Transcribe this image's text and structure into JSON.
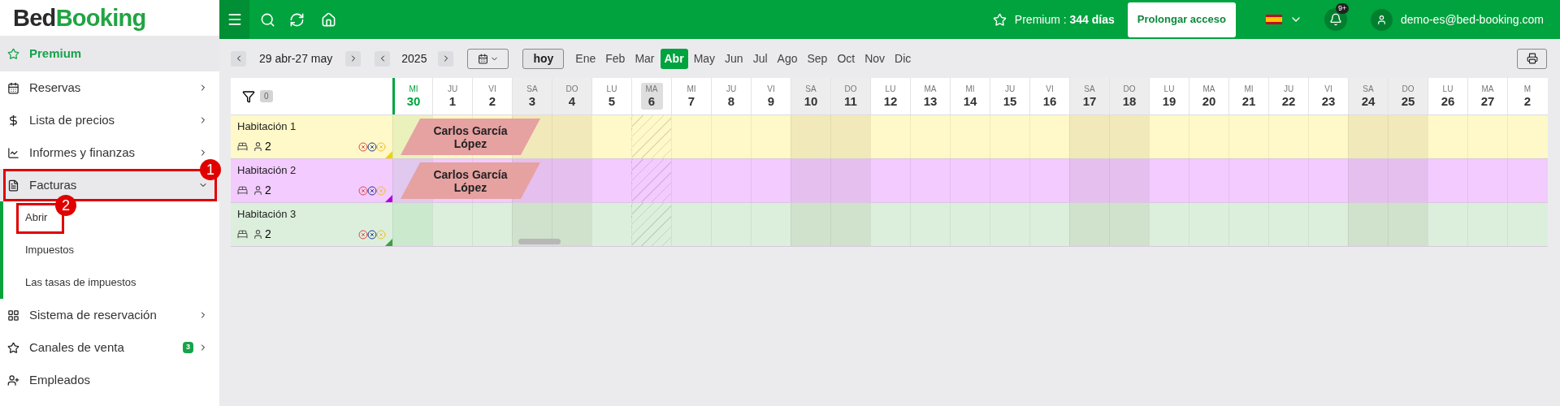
{
  "logo": {
    "part_1": "Bed",
    "part_2": "Booking"
  },
  "sidebar": {
    "items": [
      {
        "label": "Premium",
        "selected": true,
        "has_arrow": false,
        "expanded": false
      },
      {
        "label": "Reservas",
        "selected": false,
        "has_arrow": true,
        "expanded": false
      },
      {
        "label": "Lista de precios",
        "selected": false,
        "has_arrow": true,
        "expanded": false
      },
      {
        "label": "Informes y finanzas",
        "selected": false,
        "has_arrow": true,
        "expanded": false
      },
      {
        "label": "Facturas",
        "selected": false,
        "has_arrow": true,
        "expanded": true,
        "annotation": "1",
        "children": [
          {
            "label": "Abrir",
            "annotation": "2"
          },
          {
            "label": "Impuestos"
          },
          {
            "label": "Las tasas de impuestos"
          }
        ]
      },
      {
        "label": "Sistema de reservación",
        "selected": false,
        "has_arrow": true,
        "expanded": false
      },
      {
        "label": "Canales de venta",
        "selected": false,
        "has_arrow": true,
        "expanded": false,
        "badge": "3"
      },
      {
        "label": "Empleados",
        "selected": false,
        "has_arrow": false,
        "expanded": false
      }
    ]
  },
  "topbar": {
    "premium": "Premium : ",
    "premium_days": "344 días",
    "extend_button": "Prolongar acceso",
    "notifications_badge": "9+",
    "email": "demo-es@bed-booking.com"
  },
  "toolbar": {
    "range": "29 abr-27 may",
    "year": "2025",
    "today_button": "hoy",
    "months": [
      {
        "label": "Ene",
        "selected": false
      },
      {
        "label": "Feb",
        "selected": false
      },
      {
        "label": "Mar",
        "selected": false
      },
      {
        "label": "Abr",
        "selected": true
      },
      {
        "label": "May",
        "selected": false
      },
      {
        "label": "Jun",
        "selected": false
      },
      {
        "label": "Jul",
        "selected": false
      },
      {
        "label": "Ago",
        "selected": false
      },
      {
        "label": "Sep",
        "selected": false
      },
      {
        "label": "Oct",
        "selected": false
      },
      {
        "label": "Nov",
        "selected": false
      },
      {
        "label": "Dic",
        "selected": false
      }
    ]
  },
  "calendar": {
    "filter_count": "0",
    "days": [
      {
        "weekday": "MI",
        "number": "30",
        "today": true,
        "weekend": false,
        "blocked": false
      },
      {
        "weekday": "JU",
        "number": "1",
        "today": false,
        "weekend": false,
        "blocked": false
      },
      {
        "weekday": "VI",
        "number": "2",
        "today": false,
        "weekend": false,
        "blocked": false
      },
      {
        "weekday": "SA",
        "number": "3",
        "today": false,
        "weekend": true,
        "blocked": false
      },
      {
        "weekday": "DO",
        "number": "4",
        "today": false,
        "weekend": true,
        "blocked": false
      },
      {
        "weekday": "LU",
        "number": "5",
        "today": false,
        "weekend": false,
        "blocked": false
      },
      {
        "weekday": "MA",
        "number": "6",
        "today": false,
        "weekend": false,
        "blocked": true
      },
      {
        "weekday": "MI",
        "number": "7",
        "today": false,
        "weekend": false,
        "blocked": false
      },
      {
        "weekday": "JU",
        "number": "8",
        "today": false,
        "weekend": false,
        "blocked": false
      },
      {
        "weekday": "VI",
        "number": "9",
        "today": false,
        "weekend": false,
        "blocked": false
      },
      {
        "weekday": "SA",
        "number": "10",
        "today": false,
        "weekend": true,
        "blocked": false
      },
      {
        "weekday": "DO",
        "number": "11",
        "today": false,
        "weekend": true,
        "blocked": false
      },
      {
        "weekday": "LU",
        "number": "12",
        "today": false,
        "weekend": false,
        "blocked": false
      },
      {
        "weekday": "MA",
        "number": "13",
        "today": false,
        "weekend": false,
        "blocked": false
      },
      {
        "weekday": "MI",
        "number": "14",
        "today": false,
        "weekend": false,
        "blocked": false
      },
      {
        "weekday": "JU",
        "number": "15",
        "today": false,
        "weekend": false,
        "blocked": false
      },
      {
        "weekday": "VI",
        "number": "16",
        "today": false,
        "weekend": false,
        "blocked": false
      },
      {
        "weekday": "SA",
        "number": "17",
        "today": false,
        "weekend": true,
        "blocked": false
      },
      {
        "weekday": "DO",
        "number": "18",
        "today": false,
        "weekend": true,
        "blocked": false
      },
      {
        "weekday": "LU",
        "number": "19",
        "today": false,
        "weekend": false,
        "blocked": false
      },
      {
        "weekday": "MA",
        "number": "20",
        "today": false,
        "weekend": false,
        "blocked": false
      },
      {
        "weekday": "MI",
        "number": "21",
        "today": false,
        "weekend": false,
        "blocked": false
      },
      {
        "weekday": "JU",
        "number": "22",
        "today": false,
        "weekend": false,
        "blocked": false
      },
      {
        "weekday": "VI",
        "number": "23",
        "today": false,
        "weekend": false,
        "blocked": false
      },
      {
        "weekday": "SA",
        "number": "24",
        "today": false,
        "weekend": true,
        "blocked": false
      },
      {
        "weekday": "DO",
        "number": "25",
        "today": false,
        "weekend": true,
        "blocked": false
      },
      {
        "weekday": "LU",
        "number": "26",
        "today": false,
        "weekend": false,
        "blocked": false
      },
      {
        "weekday": "MA",
        "number": "27",
        "today": false,
        "weekend": false,
        "blocked": false
      },
      {
        "weekday": "M",
        "number": "2",
        "today": false,
        "weekend": false,
        "blocked": false
      }
    ],
    "rooms": [
      {
        "name": "Habitación 1",
        "guests": "2",
        "color": "#fff8c8",
        "booking": {
          "guest": "Carlos García López"
        }
      },
      {
        "name": "Habitación 2",
        "guests": "2",
        "color": "#f3cbff",
        "booking": {
          "guest": "Carlos García López"
        }
      },
      {
        "name": "Habitación 3",
        "guests": "2",
        "color": "#dcefdc"
      }
    ]
  }
}
